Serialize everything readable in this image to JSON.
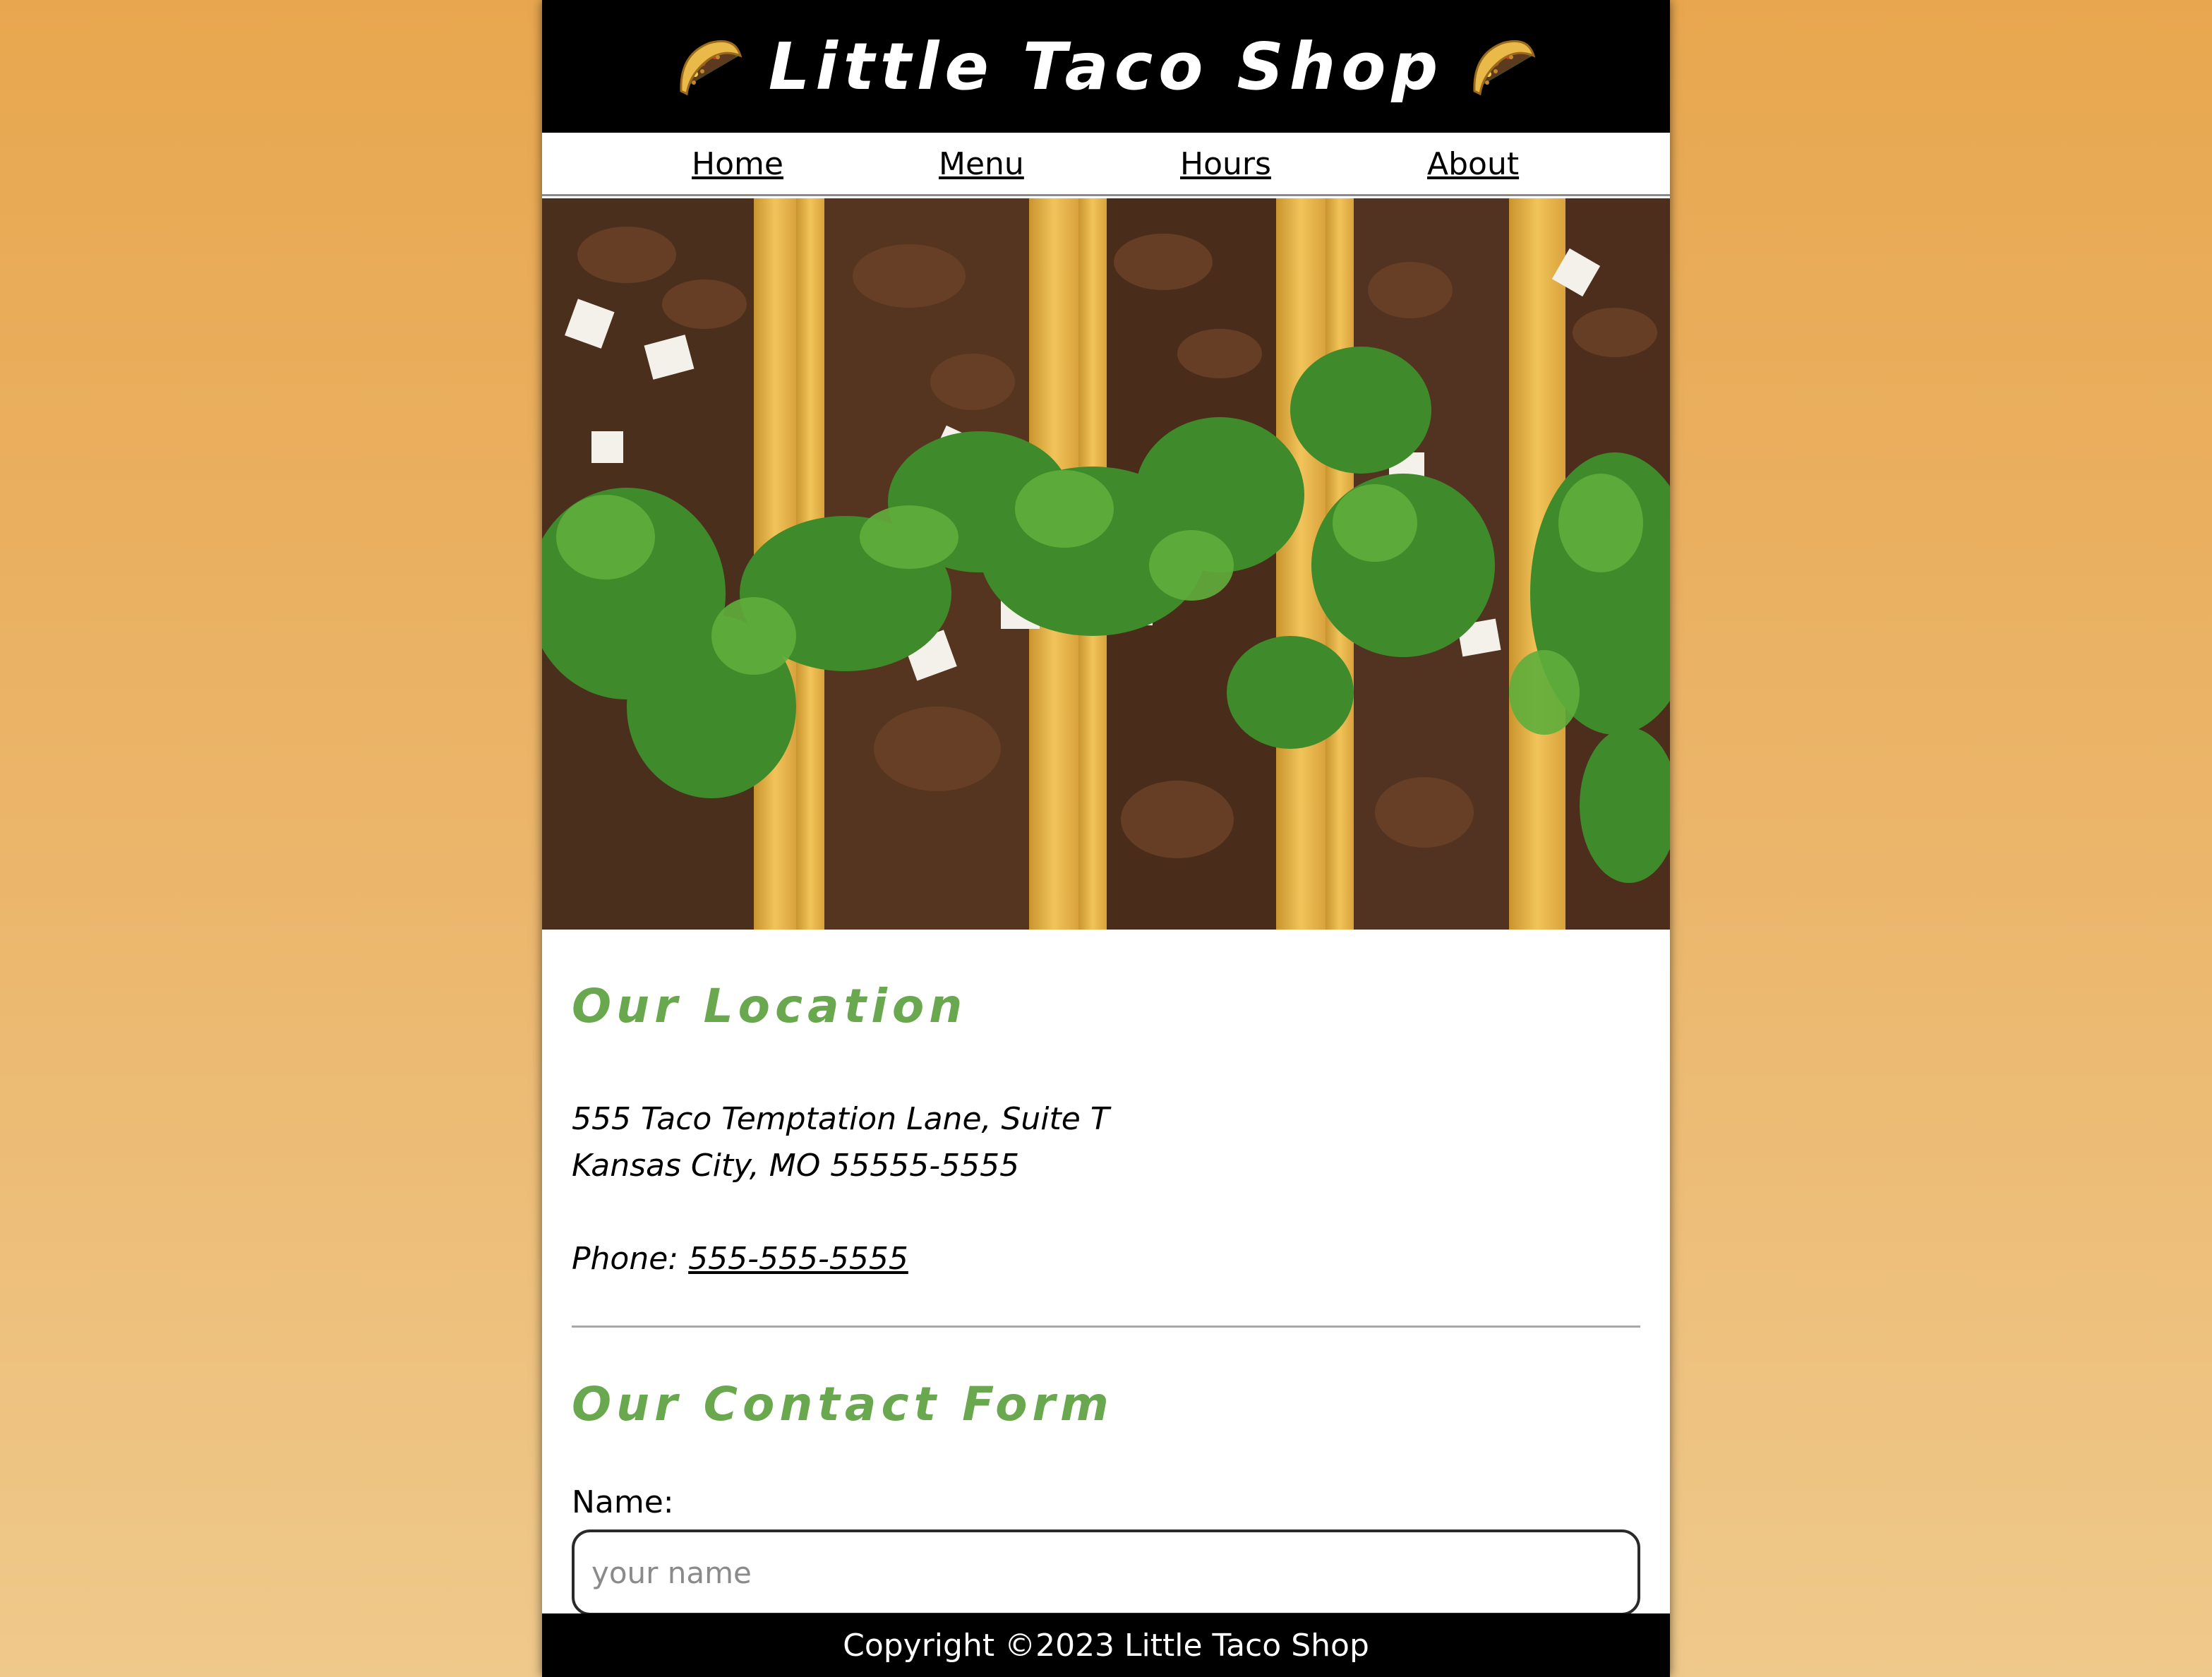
{
  "header": {
    "title": "Little Taco Shop",
    "left_icon": "taco-icon",
    "right_icon": "taco-icon",
    "background": "#000000"
  },
  "nav": {
    "items": [
      {
        "label": "Home"
      },
      {
        "label": "Menu"
      },
      {
        "label": "Hours"
      },
      {
        "label": "About"
      }
    ]
  },
  "hero": {
    "image": "tacos-photo"
  },
  "location": {
    "title": "Our Location",
    "address_line1": "555 Taco Temptation Lane, Suite T",
    "address_line2": "Kansas City, MO 55555-5555",
    "phone_label": "Phone:",
    "phone_number": "555-555-5555"
  },
  "contact": {
    "title": "Our Contact Form",
    "name_label": "Name:",
    "name_placeholder": "your name"
  },
  "footer": {
    "copyright": "Copyright ©2023 Little Taco Shop"
  },
  "colors": {
    "heading_green": "#6aa84f",
    "background_orange": "#e8a74f"
  }
}
